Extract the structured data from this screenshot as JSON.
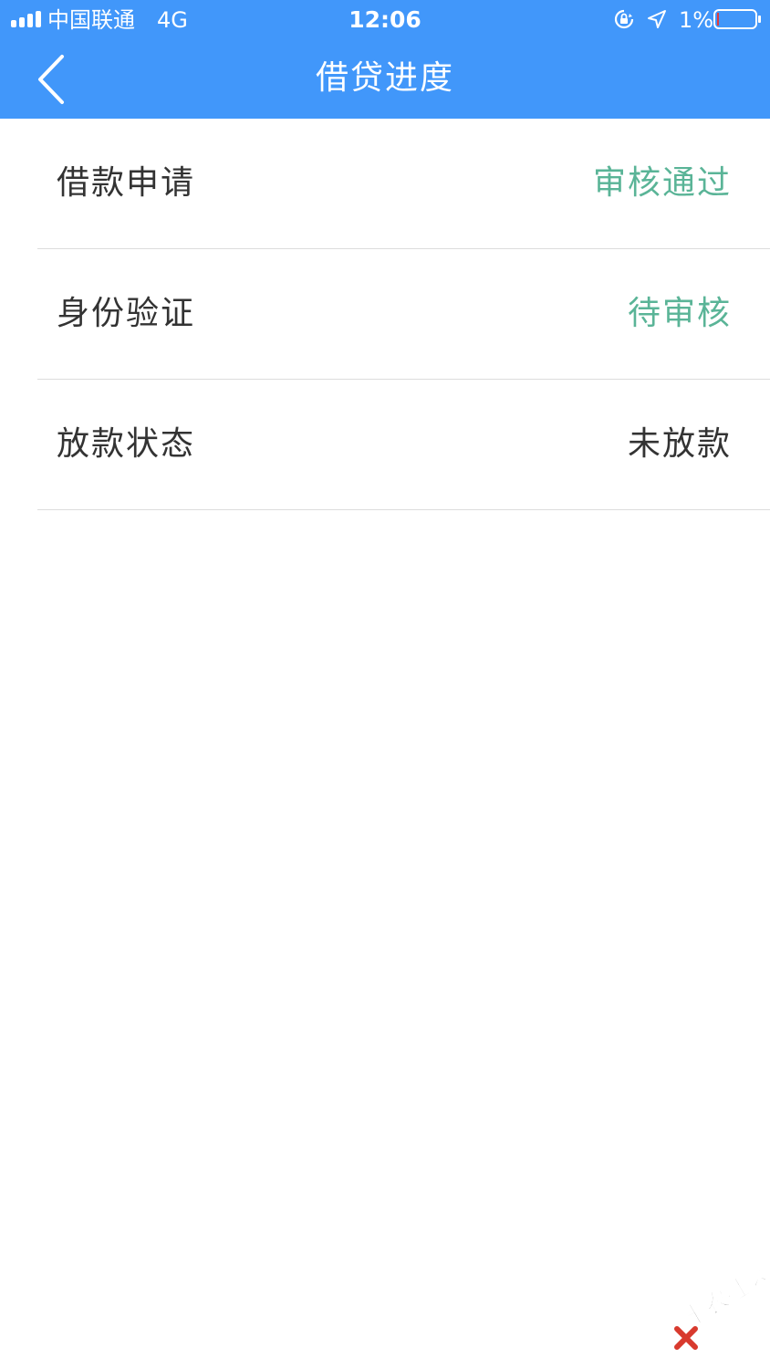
{
  "status_bar": {
    "carrier": "中国联通",
    "network": "4G",
    "time": "12:06",
    "battery": "1%"
  },
  "nav": {
    "title": "借贷进度",
    "back_icon": "chevron-left-icon"
  },
  "rows": [
    {
      "label": "借款申请",
      "value": "审核通过",
      "value_color": "#5ab497"
    },
    {
      "label": "身份验证",
      "value": "待审核",
      "value_color": "#5ab497"
    },
    {
      "label": "放款状态",
      "value": "未放款",
      "value_color": "#333333"
    }
  ],
  "watermark": {
    "text": "卡农社区"
  },
  "colors": {
    "header": "#4197fa",
    "accent_green": "#5ab497",
    "text_dark": "#333333",
    "divider": "#dcdcdc"
  }
}
